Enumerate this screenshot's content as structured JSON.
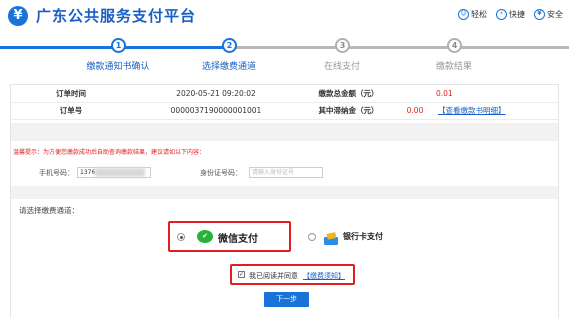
{
  "header": {
    "logo_glyph": "¥",
    "title": "广东公共服务支付平台",
    "links": [
      {
        "label": "轻松",
        "icon": "smile-icon",
        "glyph": "☺"
      },
      {
        "label": "快捷",
        "icon": "lightning-icon",
        "glyph": "⚡"
      },
      {
        "label": "安全",
        "icon": "shield-yen-icon",
        "glyph": "¥"
      }
    ]
  },
  "steps": [
    {
      "num": "1",
      "label": "缴款通知书确认",
      "state": "done"
    },
    {
      "num": "2",
      "label": "选择缴费通道",
      "state": "current"
    },
    {
      "num": "3",
      "label": "在线支付",
      "state": "pending"
    },
    {
      "num": "4",
      "label": "缴款结果",
      "state": "pending"
    }
  ],
  "order": {
    "time_label": "订单时间",
    "time_value": "2020-05-21 09:20:02",
    "total_label": "缴款总金额（元）",
    "total_value": "0.01",
    "no_label": "订单号",
    "no_value": "0000037190000001001",
    "late_fee_label": "其中滞纳金（元）",
    "late_fee_value": "0.00",
    "detail_link": "【查看缴款书明细】"
  },
  "tip": "温馨提示：为方便您缴款成功后自助查询缴款结果，建议请如以下内容：",
  "form": {
    "phone_label": "手机号码：",
    "phone_value": "1376",
    "id_label": "身份证号码：",
    "id_placeholder": "请输入身份证号"
  },
  "channel": {
    "select_label": "请选择缴费通道：",
    "wechat_label": "微信支付",
    "wechat_icon": "wechat-icon",
    "bank_label": "银行卡支付",
    "bank_icon": "bank-card-icon",
    "selected": "wechat"
  },
  "agreement": {
    "checked": true,
    "text": "我已阅读并同意",
    "link": "【缴费须知】"
  },
  "next_button": "下一步",
  "colors": {
    "brand_blue": "#1a73d9",
    "highlight_red": "#e02020",
    "wechat_green": "#27b33b"
  }
}
